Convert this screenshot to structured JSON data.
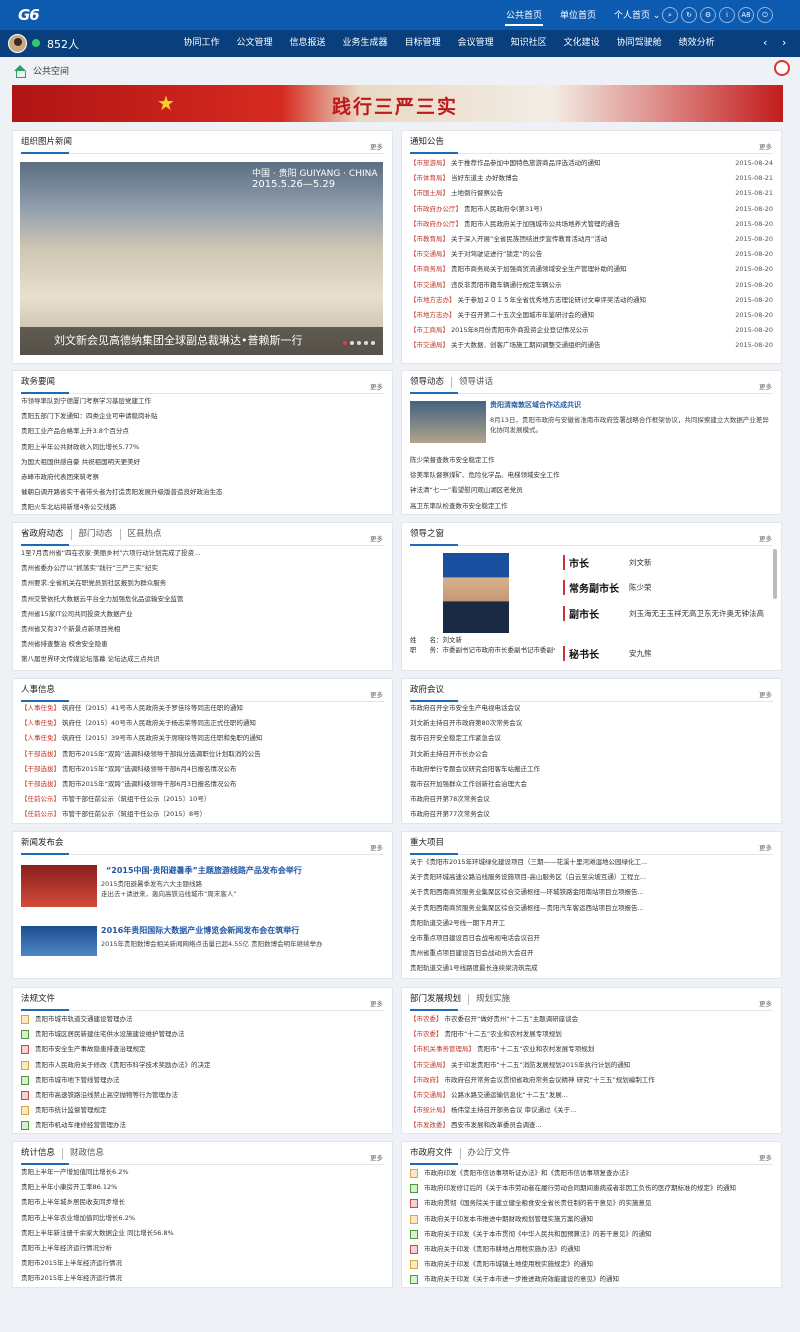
{
  "top": {
    "logo": "G6",
    "tabs": [
      "公共首页",
      "单位首页",
      "个人首页"
    ],
    "icons": [
      "search-icon",
      "refresh-icon",
      "settings-icon",
      "info-icon",
      "font-size-icon",
      "power-icon"
    ],
    "font_label": "A8"
  },
  "nav": {
    "online": "852人",
    "items": [
      "协同工作",
      "公文管理",
      "信息报送",
      "业务生成器",
      "目标管理",
      "会议管理",
      "知识社区",
      "文化建设",
      "协同驾驶舱",
      "绩效分析"
    ]
  },
  "crumb": "公共空间",
  "banner": {
    "text": "践行三严三实"
  },
  "org_news": {
    "title": "组织图片新闻",
    "more": "更多",
    "caption": "刘文新会见高德纳集团全球副总裁琳达•普赖斯一行",
    "photo_text1": "中国 · 贵阳  GUIYANG · CHINA",
    "photo_text2": "2015.5.26—5.29"
  },
  "notice": {
    "title": "通知公告",
    "more": "更多",
    "items": [
      {
        "tag": "【市旅游局】",
        "text": "关于推荐作品参加中国特色旅游商品评选活动的通知",
        "date": "2015-08-24"
      },
      {
        "tag": "【市体育局】",
        "text": "当好东道主 办好数博会",
        "date": "2015-08-21"
      },
      {
        "tag": "【市国土局】",
        "text": "土地倒行督察公告",
        "date": "2015-08-21"
      },
      {
        "tag": "【市政府办公厅】",
        "text": "贵阳市人民政府令(第31号)",
        "date": "2015-08-20"
      },
      {
        "tag": "【市政府办公厅】",
        "text": "贵阳市人民政府关于加强城市公共场地养犬管理的通告",
        "date": "2015-08-20"
      },
      {
        "tag": "【市教育局】",
        "text": "关于深入开展“全省民族团结进步宣传教育活动月”活动",
        "date": "2015-08-20"
      },
      {
        "tag": "【市交通局】",
        "text": "关于对驾驶证进行“锁定”的公告",
        "date": "2015-08-20"
      },
      {
        "tag": "【市商务局】",
        "text": "贵阳市商务局关于加强商贸流通领域安全生产管理补助的通知",
        "date": "2015-08-20"
      },
      {
        "tag": "【市交通局】",
        "text": "违反非贵阳市籍车辆通行规定车辆公示",
        "date": "2015-08-20"
      },
      {
        "tag": "【市地方志办】",
        "text": "关于参加２０１５年全省优秀地方志理论研讨文章评奖活动的通知",
        "date": "2015-08-20"
      },
      {
        "tag": "【市地方志办】",
        "text": "关于召开第二十五次全国城市年鉴研讨会的通知",
        "date": "2015-08-20"
      },
      {
        "tag": "【市工商局】",
        "text": "2015年8月份贵阳市外商投资企业登记情况公示",
        "date": "2015-08-20"
      },
      {
        "tag": "【市交通局】",
        "text": "关于大数据．创客广场施工期间调整交通组织的通告",
        "date": "2015-08-20"
      }
    ]
  },
  "gov_news": {
    "title": "政务要闻",
    "more": "更多",
    "items": [
      "市领导率队到宁德厦门考察学习基层党建工作",
      "贵阳五部门下发通知：四类企业可申请稳岗补贴",
      "贵阳工业产品合格率上升3.8个百分点",
      "贵阳上半年公共财政收入同比增长5.77%",
      "为国大祖国供感自豪 共祝祖国明天更美好",
      "赤峰市政府代表团来筑考察",
      "催朝白调开路省实干者带头者为打造贵阳发展升级版普造良好政治生态",
      "贵阳火车北站将新增4条公交线路"
    ]
  },
  "leader": {
    "tabs": [
      "领导动态",
      "领导讲话"
    ],
    "more": "更多",
    "headline": "贵阳清南敦区域合作达成共识",
    "summary": "8月13日，贵阳市政府与安徽省淮南市政府签署战略合作框架协议，共同探索建立大数据产业差异化协同发展模式。",
    "items": [
      "陈少荣督查数市安全稳定工作",
      "徐美率队督察煤矿、危险化学品、电梯领域安全工作",
      "钟法清“七·一”看望慰问观山湖区老党员",
      "高卫东率队检查数市安全稳定工作"
    ]
  },
  "prov": {
    "tabs": [
      "省政府动态",
      "部门动态",
      "区县热点"
    ],
    "more": "更多",
    "items": [
      "1至7月贵州省“四在农家·美丽乡村”六项行动计划完成了投资...",
      "贵州省委办公厅以“抓落实”践行“三严三实”纪实",
      "贵州要求:全省机关在职党员到社区报到为群众服务",
      "贵州交警依托大数据云平台全力加强危化品运输安全监管",
      "贵州省15家IT公司共同投资大数据产业",
      "贵州省又有37个新景点新项目亮相",
      "贵州省排查整治 校舍安全隐患",
      "第八届世界环文传媒论坛落幕 论坛达成三点共识"
    ]
  },
  "window": {
    "title": "领导之窗",
    "more": "更多",
    "name_label": "姓　　名：",
    "name": "刘文新",
    "post_label": "职　　务：",
    "post": "市委副书记市政府市长委副书记市委副书记市政府市长委委",
    "roles": [
      {
        "role": "市长",
        "names": "刘文新"
      },
      {
        "role": "常务副市长",
        "names": "陈少荣"
      },
      {
        "role": "副市长",
        "names": "刘玉海无王玉祥无高卫东无许奥无钟法高"
      },
      {
        "role": "秘书长",
        "names": "安九熊"
      }
    ]
  },
  "hr": {
    "title": "人事信息",
    "more": "更多",
    "items": [
      {
        "tag": "【人事任免】",
        "text": "筑府任〔2015〕41号市人民政府关于罗佳玲等同志任职的通知"
      },
      {
        "tag": "【人事任免】",
        "text": "筑府任〔2015〕40号市人民政府关于杨志荣等同志正式任职的通知"
      },
      {
        "tag": "【人事任免】",
        "text": "筑府任〔2015〕39号市人民政府关于席晓玲等同志任职和免职的通知"
      },
      {
        "tag": "【干部选拔】",
        "text": "贵阳市2015年“双跨”选调科级领导干部拟分选调职位计划取消的公告"
      },
      {
        "tag": "【干部选拔】",
        "text": "贵阳市2015年“双跨”选调科级领导干部6月4日报名情况公布"
      },
      {
        "tag": "【干部选拔】",
        "text": "贵阳市2015年“双跨”选调科级领导干部6月3日报名情况公布"
      },
      {
        "tag": "【任前公示】",
        "text": "市管干部任前公示（筑组干任公示〔2015〕10号）"
      },
      {
        "tag": "【任前公示】",
        "text": "市管干部任前公示（筑组干任公示〔2015〕8号）"
      }
    ]
  },
  "meeting": {
    "title": "政府会议",
    "more": "更多",
    "items": [
      "市政府召开全市安全生产电视电话会议",
      "刘文新主持召开市政府第80次常务会议",
      "我市召开安全稳定工作紧急会议",
      "刘文新主持召开市长办公会",
      "市政府举行专题会议研究会阳客车站搬迁工作",
      "我市召开加强群众工作创新社会治理大会",
      "市政府召开第78次常务会议",
      "市政府召开第77次常务会议"
    ]
  },
  "press": {
    "title": "新闻发布会",
    "more": "更多",
    "items": [
      {
        "title": "“2015中国·贵阳避暑季”主题旅游线路产品发布会举行",
        "desc": "2015贵阳避暑季发布六大主题线路\n走出去+请进来，轰向高铁沿线城市“周末客人”"
      },
      {
        "title": "2016年贵阳国际大数据产业博览会新闻发布会在筑举行",
        "desc": "2015年贵阳数博会相关新闻网络点击量已超4.55亿 贵阳数博会明年继续举办"
      }
    ]
  },
  "project": {
    "title": "重大项目",
    "more": "更多",
    "items": [
      "关于《贵阳市2015年环城绿化建设项目（三期——花溪十里河滩湿地公园绿化工...",
      "关于贵阳环城高速公路沿线服务设施项目-高山服务区（白云至尖坡互通）工程立...",
      "关于贵阳西南商贸服务业集聚区综合交通枢纽—环城铁路金阳南站项目立项报告...",
      "关于贵阳西南商贸服务业集聚区综合交通枢纽—贵阳汽车客运西站项目立项报告...",
      "贵阳轨道交通2号线一期下月开工",
      "全市重点项目建设百日会战电视电话会议召开",
      "贵州省重点项目建设百日会战动员大会召开",
      "贵阳轨道交通1号线路度最长连续梁浇筑完成"
    ]
  },
  "law": {
    "title": "法规文件",
    "more": "更多",
    "items": [
      "贵阳市城市轨道交通建设管理办法",
      "贵阳市城区居民新建住宅供水设施建设维护管理办法",
      "贵阳市安全生产事故隐患排查治理规定",
      "贵阳市人民政府关于修改《贵阳市科学技术奖励办法》的决定",
      "贵阳市城市地下管线管理办法",
      "贵阳市高速铁路沿线禁止高空抛物等行为管理办法",
      "贵阳市统计监督管理规定",
      "贵阳市机动车维修经营管理办法"
    ]
  },
  "dept": {
    "tabs": [
      "部门发展规划",
      "规划实施"
    ],
    "more": "更多",
    "items": [
      {
        "tag": "【市农委】",
        "text": "市农委召开“做好贵州“十二五”主题调研座谈会"
      },
      {
        "tag": "【市农委】",
        "text": "贵阳市“十二五”农业和农村发展专项规划"
      },
      {
        "tag": "【市机关事务管理局】",
        "text": "贵阳市“十二五”农业和农村发展专项规划"
      },
      {
        "tag": "【市交通局】",
        "text": "关于印发贵阳市“十二五”消防发展规划2015年执行计划的通知"
      },
      {
        "tag": "【市政府】",
        "text": "市政府召开常务会议贯彻省政府常务会议精神 研究“十三五”规划编制工作"
      },
      {
        "tag": "【市交通局】",
        "text": "公路水路交通运输信息化“十二五”发展..."
      },
      {
        "tag": "【市统计局】",
        "text": "杨伟堂主持召开部务会议 审议通过《关于..."
      },
      {
        "tag": "【市发改委】",
        "text": "西安市发展和改革委员会调查..."
      }
    ]
  },
  "stats": {
    "tabs": [
      "统计信息",
      "财政信息"
    ],
    "more": "更多",
    "items": [
      "贵阳上半年一产增加值同比增长6.2%",
      "贵阳上半年小康房开工率86.12%",
      "贵阳市上半年城乡居民收支同步增长",
      "贵阳市上半年农业增加值同比增长6.2%",
      "贵阳上半年新注册千余家大数据企业 同比增长56.8%",
      "贵阳市上半年经济运行情况分析",
      "贵阳市2015年上半年经济运行情况",
      "贵阳市2015年上半年经济运行情况"
    ]
  },
  "docs": {
    "tabs": [
      "市政府文件",
      "办公厅文件"
    ],
    "more": "更多",
    "items": [
      "市政府印发《贵阳市信访事项听证办法》和《贵阳市信访事项复查办法》",
      "市政府印发修订后的《关于本市劳动者在履行劳动合同期间患病或者非因工负伤的医疗期标准的规定》的通知",
      "市政府贯彻《国务院关于建立健全粮食安全省长责任制的若干意见》的实施意见",
      "市政府关于印发本市推进中期财政规划管理实施方案的通知",
      "市政府关于印发《关于本市贯彻《中华人民共和国预算法》的若干意见》的通知",
      "市政府关于印发《贵阳市耕地占用税实施办法》的通知",
      "市政府关于印发《贵阳市城镇土地使用税实施规定》的通知",
      "市政府关于印发《关于本市进一步推进政府效能建设的意见》的通知"
    ]
  }
}
